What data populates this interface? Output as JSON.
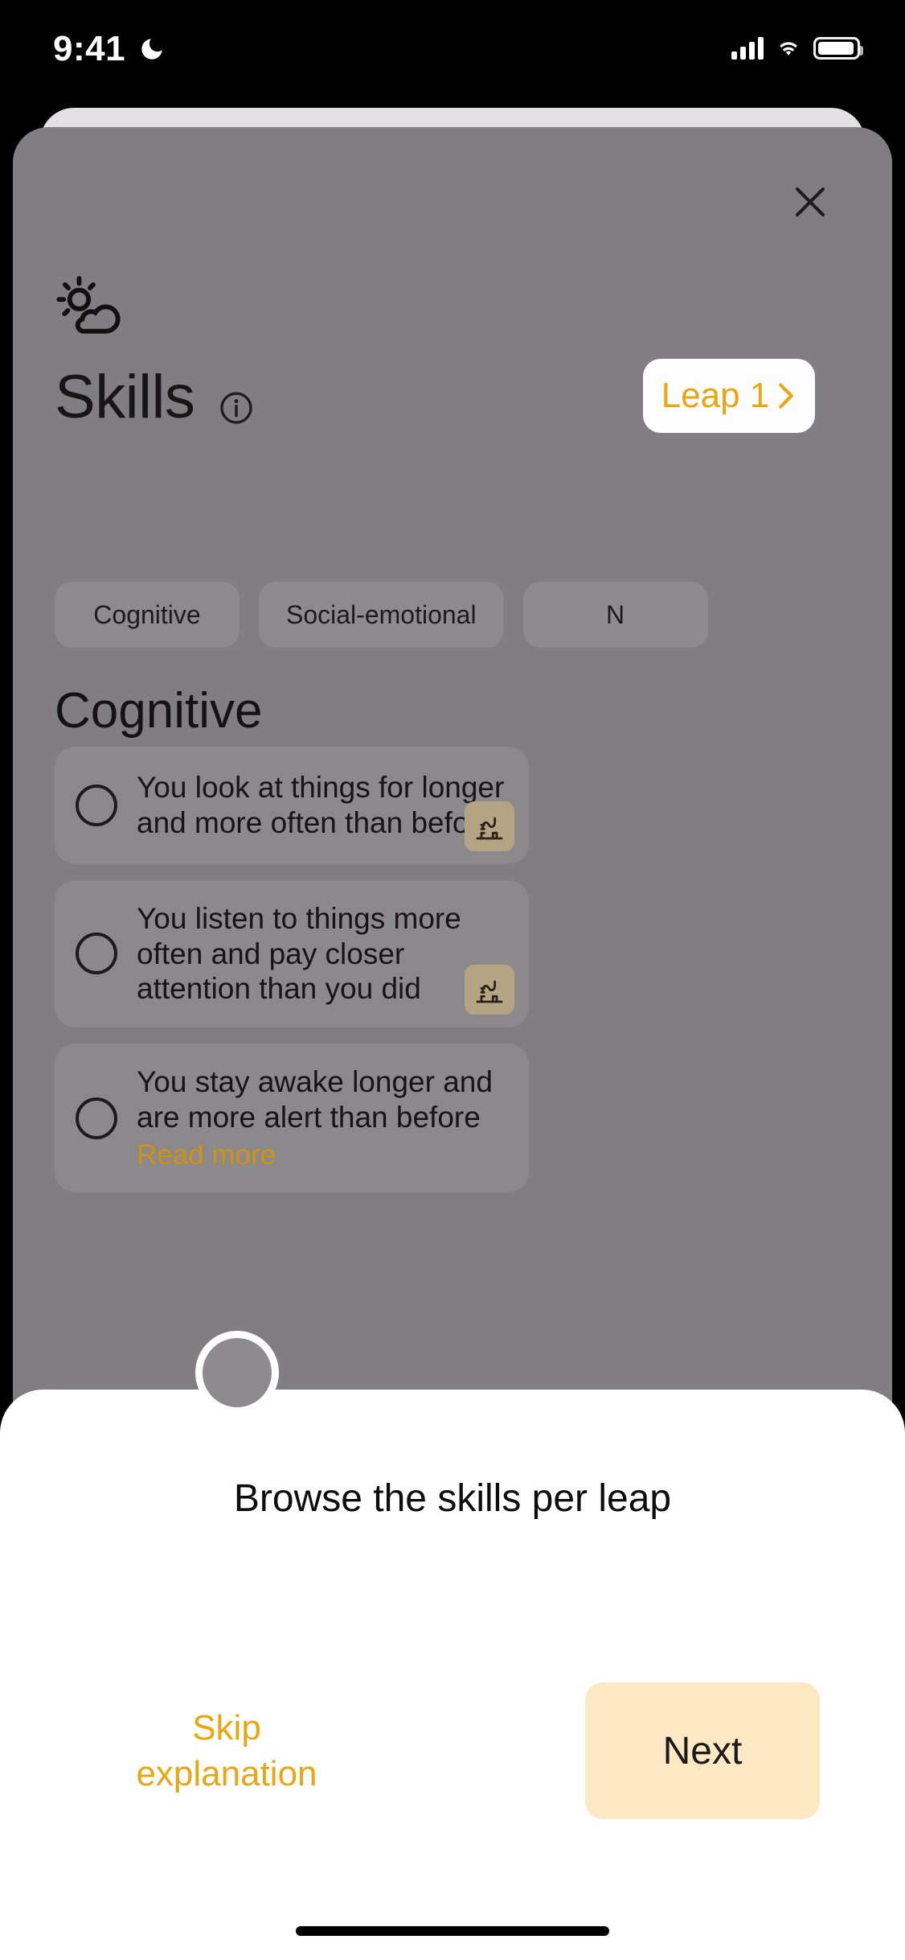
{
  "status_bar": {
    "time": "9:41",
    "dnd_icon": "moon-icon",
    "signal_icon": "cellular-signal-icon",
    "wifi_icon": "wifi-icon",
    "battery_icon": "battery-icon"
  },
  "modal": {
    "close_icon": "close-icon",
    "weather_icon": "sun-behind-cloud-icon",
    "title": "Skills",
    "info_icon": "info-icon",
    "leap_button": {
      "label": "Leap 1",
      "chevron_icon": "chevron-right-icon",
      "accent_color": "#eaa612",
      "background": "#fdfdfd"
    },
    "tabs": [
      {
        "label": "Cognitive",
        "selected": true
      },
      {
        "label": "Social-emotional",
        "selected": false
      },
      {
        "label": "N",
        "selected": false
      }
    ],
    "section_title": "Cognitive",
    "skills": [
      {
        "text": "You look at things for longer and more often than before",
        "checked": false,
        "badge_icon": "play-gym-icon",
        "read_more": ""
      },
      {
        "text": "You listen to things more often and pay closer attention than you did",
        "checked": false,
        "badge_icon": "play-gym-icon",
        "read_more": ""
      },
      {
        "text": "You stay awake longer and are more alert than before",
        "checked": false,
        "badge_icon": "",
        "read_more": "Read more"
      }
    ]
  },
  "bottom_sheet": {
    "heading": "Browse the skills per leap",
    "skip_label": "Skip explanation",
    "next_label": "Next",
    "next_background": "#fce9c4",
    "accent_color": "#eaa612"
  },
  "colors": {
    "overlay": "#807e82",
    "accent": "#eaa612",
    "badge": "#b5a484"
  }
}
